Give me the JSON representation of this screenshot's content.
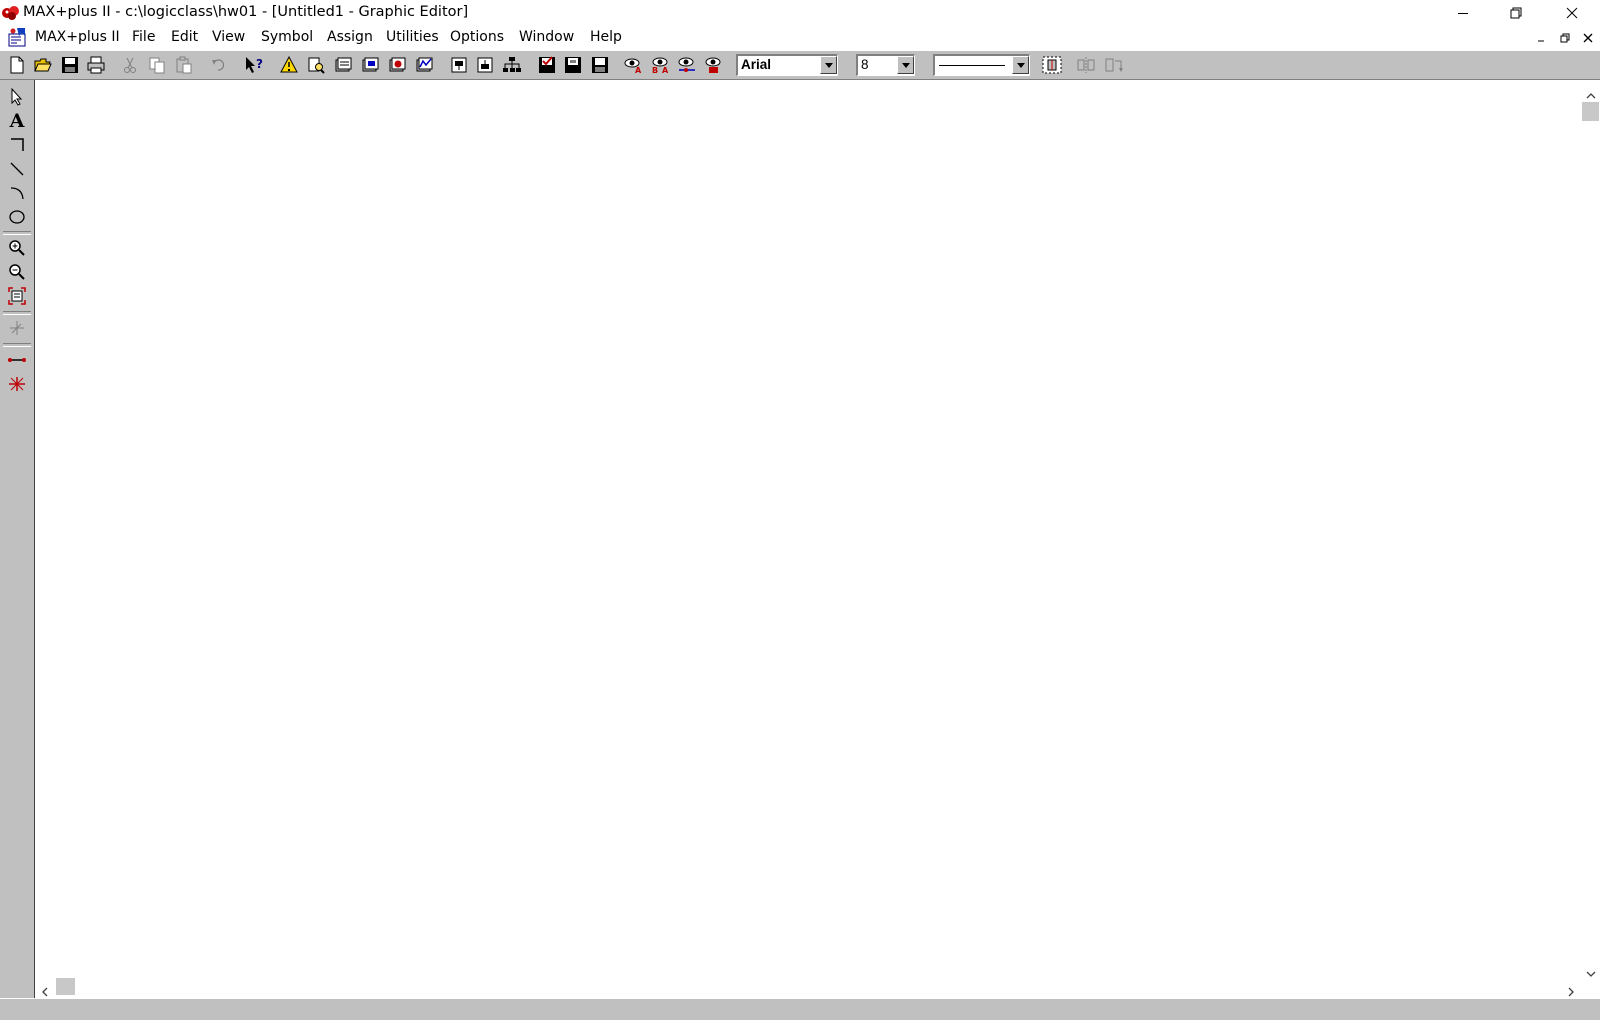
{
  "window": {
    "title": "MAX+plus II - c:\\logicclass\\hw01 - [Untitled1 - Graphic Editor]"
  },
  "menu": {
    "items": [
      "MAX+plus II",
      "File",
      "Edit",
      "View",
      "Symbol",
      "Assign",
      "Utilities",
      "Options",
      "Window",
      "Help"
    ]
  },
  "toolbar": {
    "font_name": "Arial",
    "font_size": "8",
    "line_style": "solid"
  },
  "palette": {
    "text_tool_glyph": "A"
  },
  "colors": {
    "face": "#c0c0c0",
    "canvas": "#ffffff",
    "accent_red": "#c00000",
    "accent_yellow": "#ffd800"
  }
}
